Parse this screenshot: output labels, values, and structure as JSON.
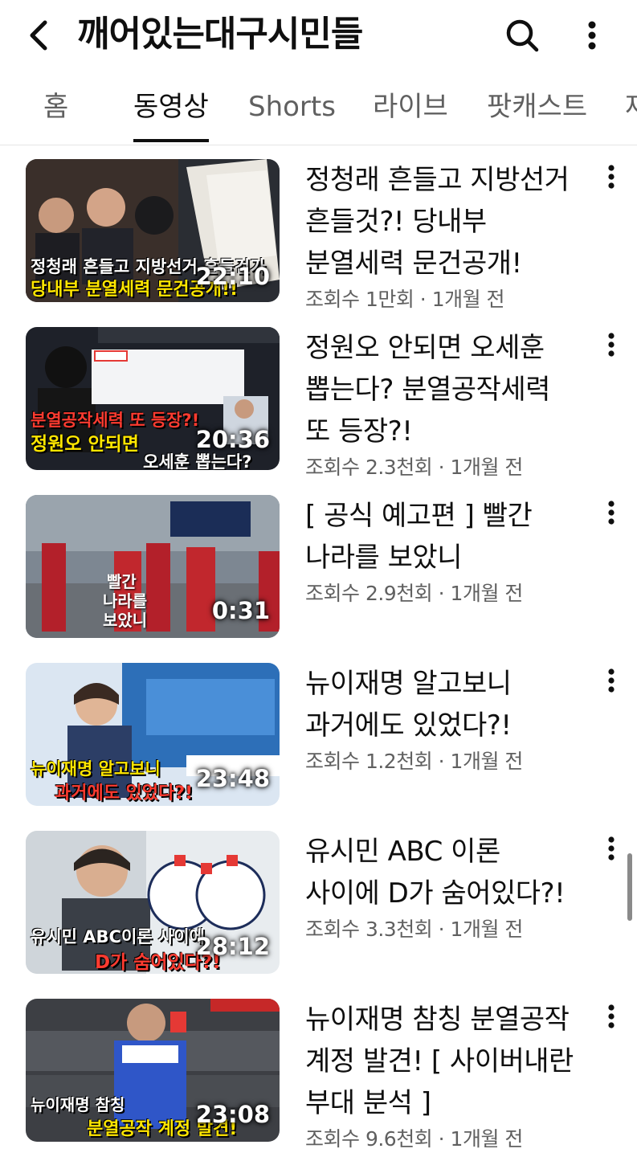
{
  "header": {
    "title": "깨어있는대구시민들",
    "back_icon": "back-arrow-icon",
    "search_icon": "search-icon",
    "more_icon": "more-vertical-icon"
  },
  "tabs": [
    {
      "label": "홈",
      "active": false
    },
    {
      "label": "동영상",
      "active": true
    },
    {
      "label": "Shorts",
      "active": false
    },
    {
      "label": "라이브",
      "active": false
    },
    {
      "label": "팟캐스트",
      "active": false
    },
    {
      "label": "재",
      "active": false
    }
  ],
  "videos": [
    {
      "title": "정청래 흔들고 지방선거 흔들것?! 당내부 분열세력 문건공개!",
      "stats": "조회수 1만회 · 1개월 전",
      "duration": "22:10",
      "thumb_caption_1": "정청래 흔들고 지방선거 흔들건가",
      "thumb_caption_2": "당내부 분열세력 문건공개!!"
    },
    {
      "title": "정원오 안되면 오세훈 뽑는다? 분열공작세력 또 등장?!",
      "stats": "조회수 2.3천회 · 1개월 전",
      "duration": "20:36",
      "thumb_caption_1": "분열공작세력 또 등장?!",
      "thumb_caption_2": "정원오 안되면",
      "thumb_caption_3": "오세훈 뽑는다?"
    },
    {
      "title": "[ 공식 예고편 ] 빨간 나라를 보았니",
      "stats": "조회수 2.9천회 · 1개월 전",
      "duration": "0:31",
      "thumb_caption_1": "빨간",
      "thumb_caption_2": "나라를",
      "thumb_caption_3": "보았니"
    },
    {
      "title": "뉴이재명 알고보니 과거에도 있었다?!",
      "stats": "조회수 1.2천회 · 1개월 전",
      "duration": "23:48",
      "thumb_caption_1": "뉴이재명 알고보니",
      "thumb_caption_2": "과거에도 있었다?!"
    },
    {
      "title": "유시민 ABC 이론 사이에 D가 숨어있다?!",
      "stats": "조회수 3.3천회 · 1개월 전",
      "duration": "28:12",
      "thumb_caption_1": "유시민 ABC이론 사이에",
      "thumb_caption_2": "D가 숨어있다?!"
    },
    {
      "title": "뉴이재명 참칭 분열공작 계정 발견! [ 사이버내란 부대 분석 ]",
      "stats": "조회수 9.6천회 · 1개월 전",
      "duration": "23:08",
      "thumb_caption_1": "뉴이재명 참칭",
      "thumb_caption_2": "분열공작 계정 발견!"
    }
  ],
  "colors": {
    "text_primary": "#0f0f0f",
    "text_secondary": "#606060",
    "thumb_caption_yellow": "#ffe600",
    "thumb_caption_red": "#ff3b30"
  }
}
